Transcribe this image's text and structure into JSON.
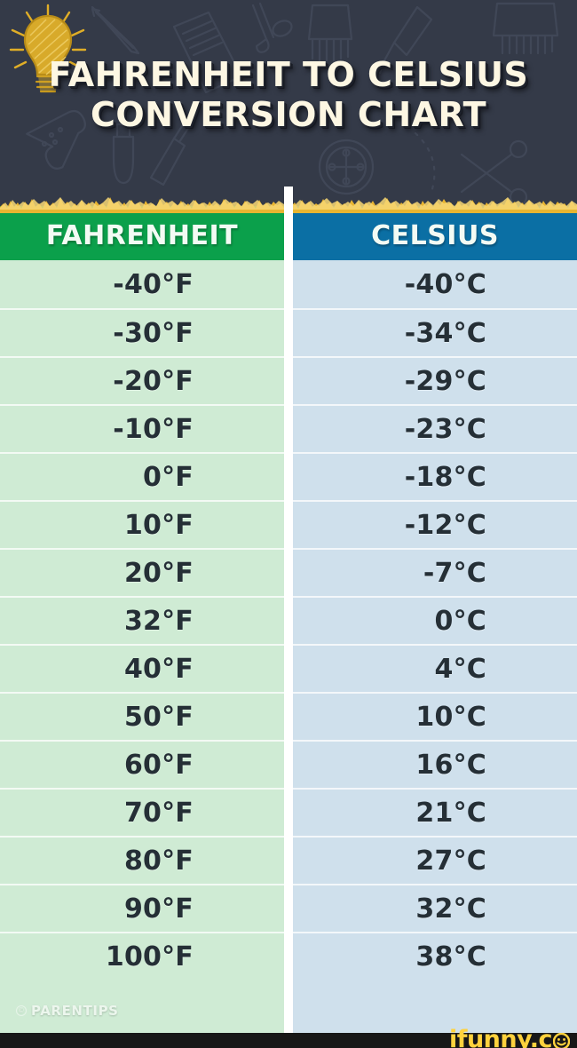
{
  "header": {
    "title_line1": "FAHRENHEIT TO CELSIUS",
    "title_line2": "CONVERSION CHART",
    "icon": "lightbulb-icon",
    "background_color": "#343a48",
    "title_color": "#fdf7e3",
    "accent_torn_edge_color": "#f0bd3a"
  },
  "table": {
    "columns": [
      {
        "label": "FAHRENHEIT",
        "header_color": "#0ba04b",
        "cell_color": "#cfebd4"
      },
      {
        "label": "CELSIUS",
        "header_color": "#0b6fa4",
        "cell_color": "#cfe0ec"
      }
    ],
    "rows": [
      {
        "fahrenheit": "-40°F",
        "celsius": "-40°C"
      },
      {
        "fahrenheit": "-30°F",
        "celsius": "-34°C"
      },
      {
        "fahrenheit": "-20°F",
        "celsius": "-29°C"
      },
      {
        "fahrenheit": "-10°F",
        "celsius": "-23°C"
      },
      {
        "fahrenheit": "0°F",
        "celsius": "-18°C"
      },
      {
        "fahrenheit": "10°F",
        "celsius": "-12°C"
      },
      {
        "fahrenheit": "20°F",
        "celsius": "-7°C"
      },
      {
        "fahrenheit": "32°F",
        "celsius": "0°C"
      },
      {
        "fahrenheit": "40°F",
        "celsius": "4°C"
      },
      {
        "fahrenheit": "50°F",
        "celsius": "10°C"
      },
      {
        "fahrenheit": "60°F",
        "celsius": "16°C"
      },
      {
        "fahrenheit": "70°F",
        "celsius": "21°C"
      },
      {
        "fahrenheit": "80°F",
        "celsius": "27°C"
      },
      {
        "fahrenheit": "90°F",
        "celsius": "32°C"
      },
      {
        "fahrenheit": "100°F",
        "celsius": "38°C"
      }
    ]
  },
  "watermark": {
    "copyright_symbol": "©",
    "text": "PARENTIPS"
  },
  "footer": {
    "brand_text": "ifunny.c",
    "brand_icon": "smiley-face-icon",
    "brand_color": "#ffd23d",
    "background_color": "#171717"
  },
  "chart_data": {
    "type": "table",
    "title": "FAHRENHEIT TO CELSIUS CONVERSION CHART",
    "xlabel": "FAHRENHEIT",
    "ylabel": "CELSIUS",
    "categories": [
      "-40°F",
      "-30°F",
      "-20°F",
      "-10°F",
      "0°F",
      "10°F",
      "20°F",
      "32°F",
      "40°F",
      "50°F",
      "60°F",
      "70°F",
      "80°F",
      "90°F",
      "100°F"
    ],
    "series": [
      {
        "name": "Fahrenheit",
        "values": [
          -40,
          -30,
          -20,
          -10,
          0,
          10,
          20,
          32,
          40,
          50,
          60,
          70,
          80,
          90,
          100
        ]
      },
      {
        "name": "Celsius",
        "values": [
          -40,
          -34,
          -29,
          -23,
          -18,
          -12,
          -7,
          0,
          4,
          10,
          16,
          21,
          27,
          32,
          38
        ]
      }
    ],
    "columns": [
      "FAHRENHEIT",
      "CELSIUS"
    ],
    "rows": [
      [
        "-40°F",
        "-40°C"
      ],
      [
        "-30°F",
        "-34°C"
      ],
      [
        "-20°F",
        "-29°C"
      ],
      [
        "-10°F",
        "-23°C"
      ],
      [
        "0°F",
        "-18°C"
      ],
      [
        "10°F",
        "-12°C"
      ],
      [
        "20°F",
        "-7°C"
      ],
      [
        "32°F",
        "0°C"
      ],
      [
        "40°F",
        "4°C"
      ],
      [
        "50°F",
        "10°C"
      ],
      [
        "60°F",
        "16°C"
      ],
      [
        "70°F",
        "21°C"
      ],
      [
        "80°F",
        "27°C"
      ],
      [
        "90°F",
        "32°C"
      ],
      [
        "100°F",
        "38°C"
      ]
    ],
    "grid": false,
    "legend_position": "none"
  }
}
